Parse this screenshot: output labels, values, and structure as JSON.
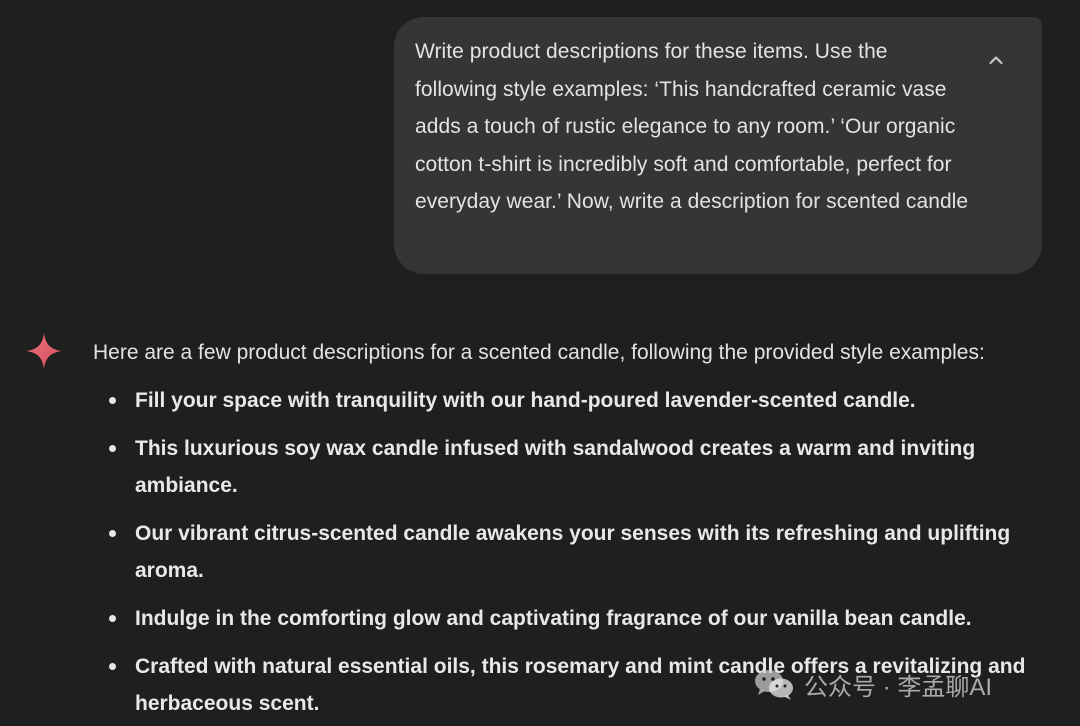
{
  "user_prompt": {
    "text": "Write product descriptions for these items. Use the following style examples: ‘This handcrafted ceramic vase adds a touch of rustic elegance to any room.’ ‘Our organic cotton t-shirt is incredibly soft and comfortable, perfect for everyday wear.’ Now, write a description for scented candle",
    "collapse_icon": "chevron-up-icon"
  },
  "response": {
    "icon": "gemini-sparkle-icon",
    "intro": "Here are a few product descriptions for a scented candle, following the provided style examples:",
    "items": [
      "Fill your space with tranquility with our hand-poured lavender-scented candle.",
      "This luxurious soy wax candle infused with sandalwood creates a warm and inviting ambiance.",
      "Our vibrant citrus-scented candle awakens your senses with its refreshing and uplifting aroma.",
      "Indulge in the comforting glow and captivating fragrance of our vanilla bean candle.",
      "Crafted with natural essential oils, this rosemary and mint candle offers a revitalizing and herbaceous scent."
    ]
  },
  "watermark": {
    "text": "公众号 · 李孟聊AI",
    "icon": "wechat-logo-icon"
  },
  "colors": {
    "background": "#1f1f1f",
    "user_bubble": "#333537",
    "text": "#e3e3e3",
    "sparkle_accent": "#e0606e"
  }
}
